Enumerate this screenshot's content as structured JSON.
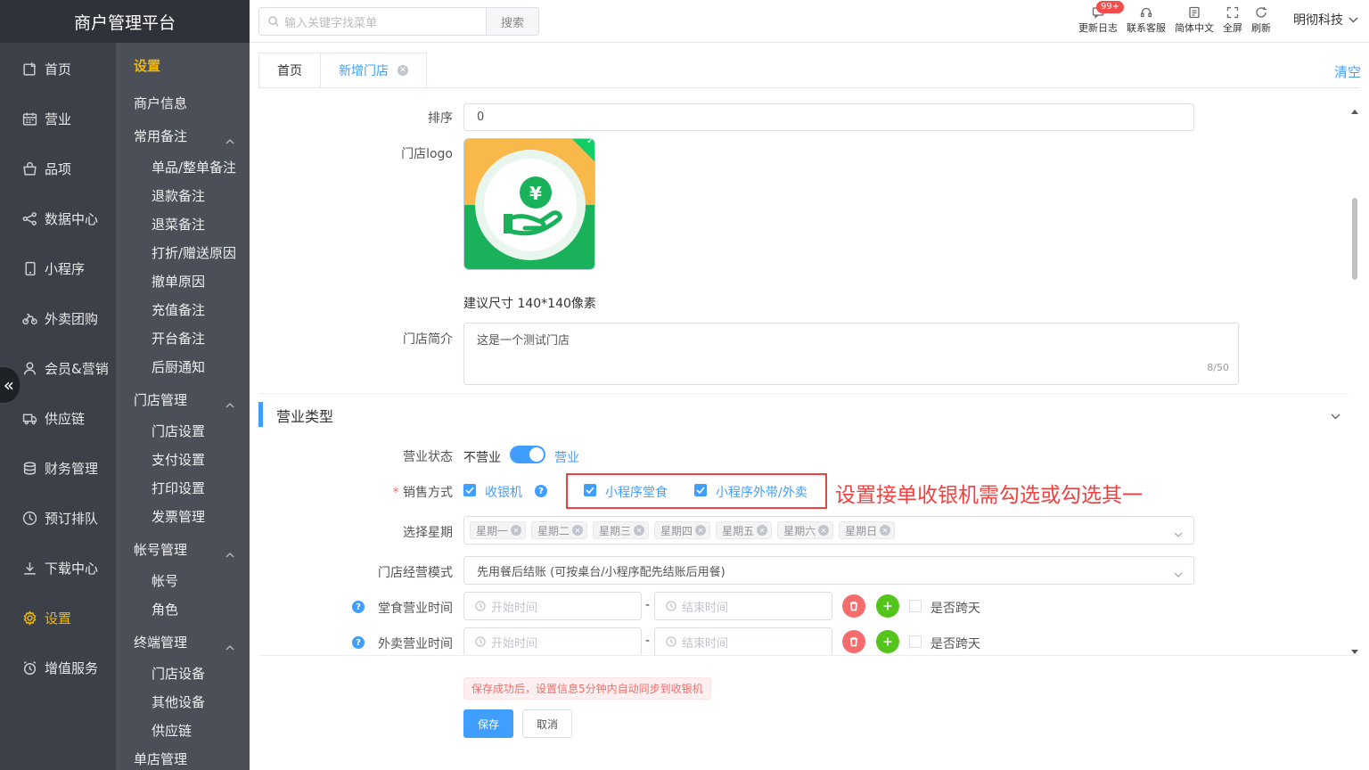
{
  "app": {
    "title": "商户管理平台"
  },
  "nav_primary": [
    {
      "label": "首页",
      "icon": "home-icon"
    },
    {
      "label": "营业",
      "icon": "calendar-icon"
    },
    {
      "label": "品项",
      "icon": "bag-icon"
    },
    {
      "label": "数据中心",
      "icon": "share-icon"
    },
    {
      "label": "小程序",
      "icon": "phone-icon"
    },
    {
      "label": "外卖团购",
      "icon": "bike-icon"
    },
    {
      "label": "会员&营销",
      "icon": "user-icon"
    },
    {
      "label": "供应链",
      "icon": "truck-icon"
    },
    {
      "label": "财务管理",
      "icon": "coins-icon"
    },
    {
      "label": "预订排队",
      "icon": "clock-icon"
    },
    {
      "label": "下载中心",
      "icon": "download-icon"
    },
    {
      "label": "设置",
      "icon": "gear-icon",
      "active": true
    },
    {
      "label": "增值服务",
      "icon": "alarm-icon"
    }
  ],
  "nav_secondary": {
    "title": "设置",
    "items": [
      {
        "label": "商户信息",
        "type": "item"
      },
      {
        "label": "常用备注",
        "type": "group"
      },
      {
        "label": "单品/整单备注",
        "type": "sub"
      },
      {
        "label": "退款备注",
        "type": "sub"
      },
      {
        "label": "退菜备注",
        "type": "sub"
      },
      {
        "label": "打折/赠送原因",
        "type": "sub"
      },
      {
        "label": "撤单原因",
        "type": "sub"
      },
      {
        "label": "充值备注",
        "type": "sub"
      },
      {
        "label": "开台备注",
        "type": "sub"
      },
      {
        "label": "后厨通知",
        "type": "sub"
      },
      {
        "label": "门店管理",
        "type": "group"
      },
      {
        "label": "门店设置",
        "type": "sub"
      },
      {
        "label": "支付设置",
        "type": "sub"
      },
      {
        "label": "打印设置",
        "type": "sub"
      },
      {
        "label": "发票管理",
        "type": "sub"
      },
      {
        "label": "帐号管理",
        "type": "group"
      },
      {
        "label": "帐号",
        "type": "sub"
      },
      {
        "label": "角色",
        "type": "sub"
      },
      {
        "label": "终端管理",
        "type": "group"
      },
      {
        "label": "门店设备",
        "type": "sub"
      },
      {
        "label": "其他设备",
        "type": "sub"
      },
      {
        "label": "供应链",
        "type": "sub"
      },
      {
        "label": "单店管理",
        "type": "item"
      }
    ]
  },
  "topbar": {
    "search_placeholder": "输入关键字找菜单",
    "search_button": "搜索",
    "badge": "99+",
    "tools": [
      {
        "label": "更新日志",
        "icon": "message-icon"
      },
      {
        "label": "联系客服",
        "icon": "headset-icon"
      },
      {
        "label": "简体中文",
        "icon": "language-icon"
      },
      {
        "label": "全屏",
        "icon": "fullscreen-icon"
      },
      {
        "label": "刷新",
        "icon": "refresh-icon"
      }
    ],
    "user": "明彻科技"
  },
  "tabs": [
    {
      "label": "首页"
    },
    {
      "label": "新增门店",
      "active": true
    }
  ],
  "clear_label": "清空",
  "form": {
    "sort_label": "排序",
    "sort_value": "0",
    "logo_label": "门店logo",
    "logo_hint": "建议尺寸 140*140像素",
    "intro_label": "门店简介",
    "intro_value": "这是一个测试门店",
    "intro_count": "8/50",
    "section_title": "营业类型",
    "status_label": "营业状态",
    "status_off": "不营业",
    "status_on": "营业",
    "status_value": true,
    "sale_mode_required": "*",
    "sale_mode_label": "销售方式",
    "sale_options": [
      {
        "label": "收银机",
        "checked": true
      },
      {
        "label": "小程序堂食",
        "checked": true
      },
      {
        "label": "小程序外带/外卖",
        "checked": true
      }
    ],
    "annotation": "设置接单收银机需勾选或勾选其一",
    "weekday_label": "选择星期",
    "weekdays": [
      "星期一",
      "星期二",
      "星期三",
      "星期四",
      "星期五",
      "星期六",
      "星期日"
    ],
    "mode_label": "门店经营模式",
    "mode_value": "先用餐后结账 (可按桌台/小程序配先结账后用餐)",
    "dine_time_label": "堂食营业时间",
    "takeout_time_label": "外卖营业时间",
    "start_placeholder": "开始时间",
    "end_placeholder": "结束时间",
    "time_sep": "-",
    "cross_day_label": "是否跨天"
  },
  "footer": {
    "sync_note": "保存成功后，设置信息5分钟内自动同步到收银机",
    "save": "保存",
    "cancel": "取消"
  },
  "colors": {
    "primary": "#409eff",
    "sidebar": "#3c4049",
    "sidebar_secondary": "#4a4f58",
    "active": "#f5b800",
    "annotation": "#f04141"
  }
}
